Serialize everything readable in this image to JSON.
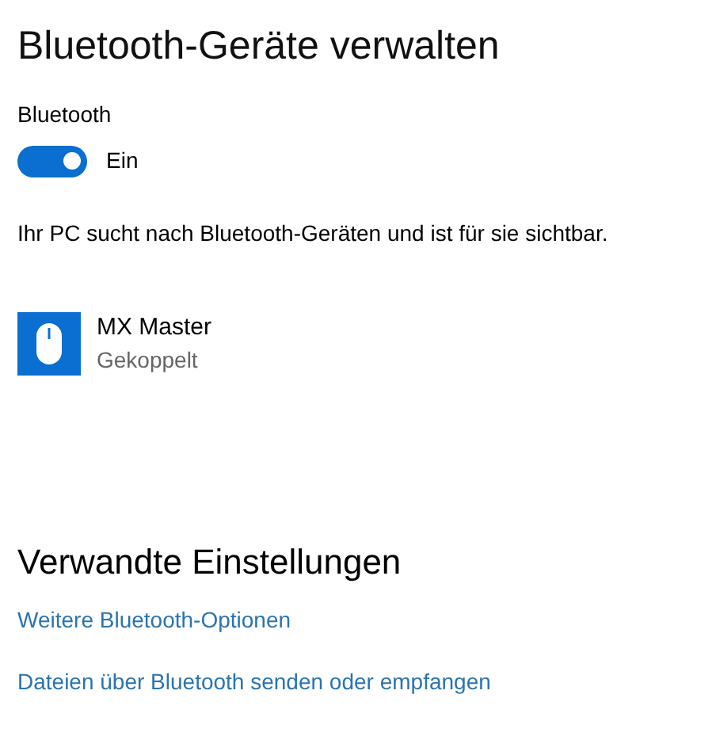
{
  "title": "Bluetooth-Geräte verwalten",
  "bluetooth": {
    "label": "Bluetooth",
    "on": true,
    "state_text": "Ein"
  },
  "status": "Ihr PC sucht nach Bluetooth-Geräten und ist für sie sichtbar.",
  "devices": [
    {
      "name": "MX Master",
      "status": "Gekoppelt"
    }
  ],
  "related": {
    "heading": "Verwandte Einstellungen",
    "links": [
      "Weitere Bluetooth-Optionen",
      "Dateien über Bluetooth senden oder empfangen"
    ]
  }
}
